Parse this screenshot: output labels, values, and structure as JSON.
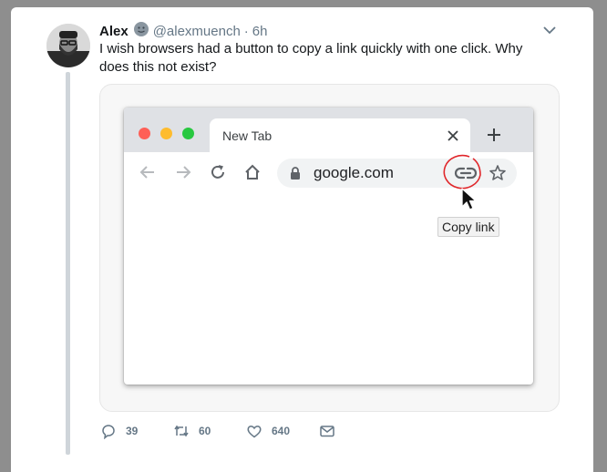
{
  "tweet": {
    "author_name": "Alex",
    "author_emoji": "🙂",
    "handle": "@alexmuench",
    "separator": "·",
    "time": "6h",
    "text": "I wish browsers had a button to copy a link quickly with one click. Why does this not exist?",
    "avatar_icon": "avatar-portrait",
    "menu_icon": "chevron-down-icon"
  },
  "browser_mock": {
    "tab_title": "New Tab",
    "url": "google.com",
    "tooltip": "Copy link",
    "traffic_lights": [
      "#fe5f57",
      "#febc2e",
      "#28c840"
    ],
    "annotation_color": "#e0262a"
  },
  "actions": {
    "replies": "39",
    "retweets": "60",
    "likes": "640"
  },
  "colors": {
    "text": "#14171a",
    "secondary": "#657786",
    "background": "#8e8e8e"
  }
}
